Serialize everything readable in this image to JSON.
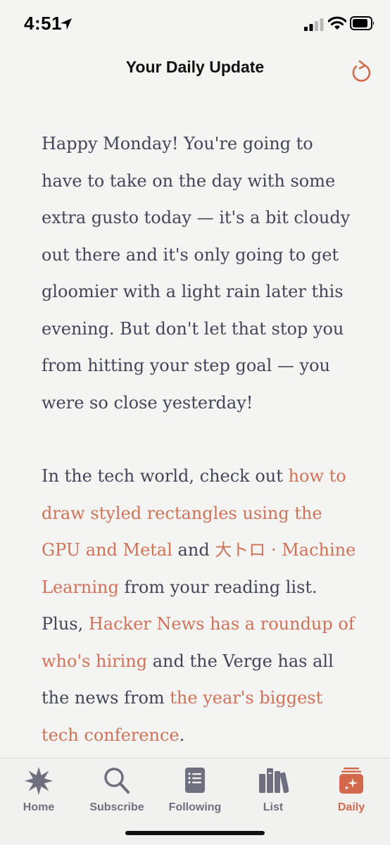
{
  "status_bar": {
    "time": "4:51"
  },
  "nav": {
    "title": "Your Daily Update",
    "refresh_icon": "refresh-icon"
  },
  "content": {
    "para1": "Happy Monday! You're going to have to take on the day with some extra gusto today — it's a bit cloudy out there and it's only going to get gloomier with a light rain later this evening. But don't let that stop you from hitting your step goal — you were so close yesterday!",
    "para2": {
      "t1": "In the tech world, check out ",
      "link1": "how to draw styled rectangles using the GPU and Metal",
      "t2": " and ",
      "link2": "大トロ · Machine Learning",
      "t3": " from your reading list. Plus, ",
      "link3": "Hacker News has a roundup of who's hiring",
      "t4": " and the Verge has all the news from ",
      "link4": "the year's biggest tech conference",
      "t5": "."
    }
  },
  "colors": {
    "accent": "#d2694d",
    "text": "#44445a",
    "tab_inactive": "#6f6f7f",
    "background": "#f4f4f2"
  },
  "tabs": [
    {
      "label": "Home",
      "icon": "home-starburst-icon",
      "active": false
    },
    {
      "label": "Subscribe",
      "icon": "search-icon",
      "active": false
    },
    {
      "label": "Following",
      "icon": "document-list-icon",
      "active": false
    },
    {
      "label": "List",
      "icon": "books-icon",
      "active": false
    },
    {
      "label": "Daily",
      "icon": "daily-sparkle-icon",
      "active": true
    }
  ]
}
